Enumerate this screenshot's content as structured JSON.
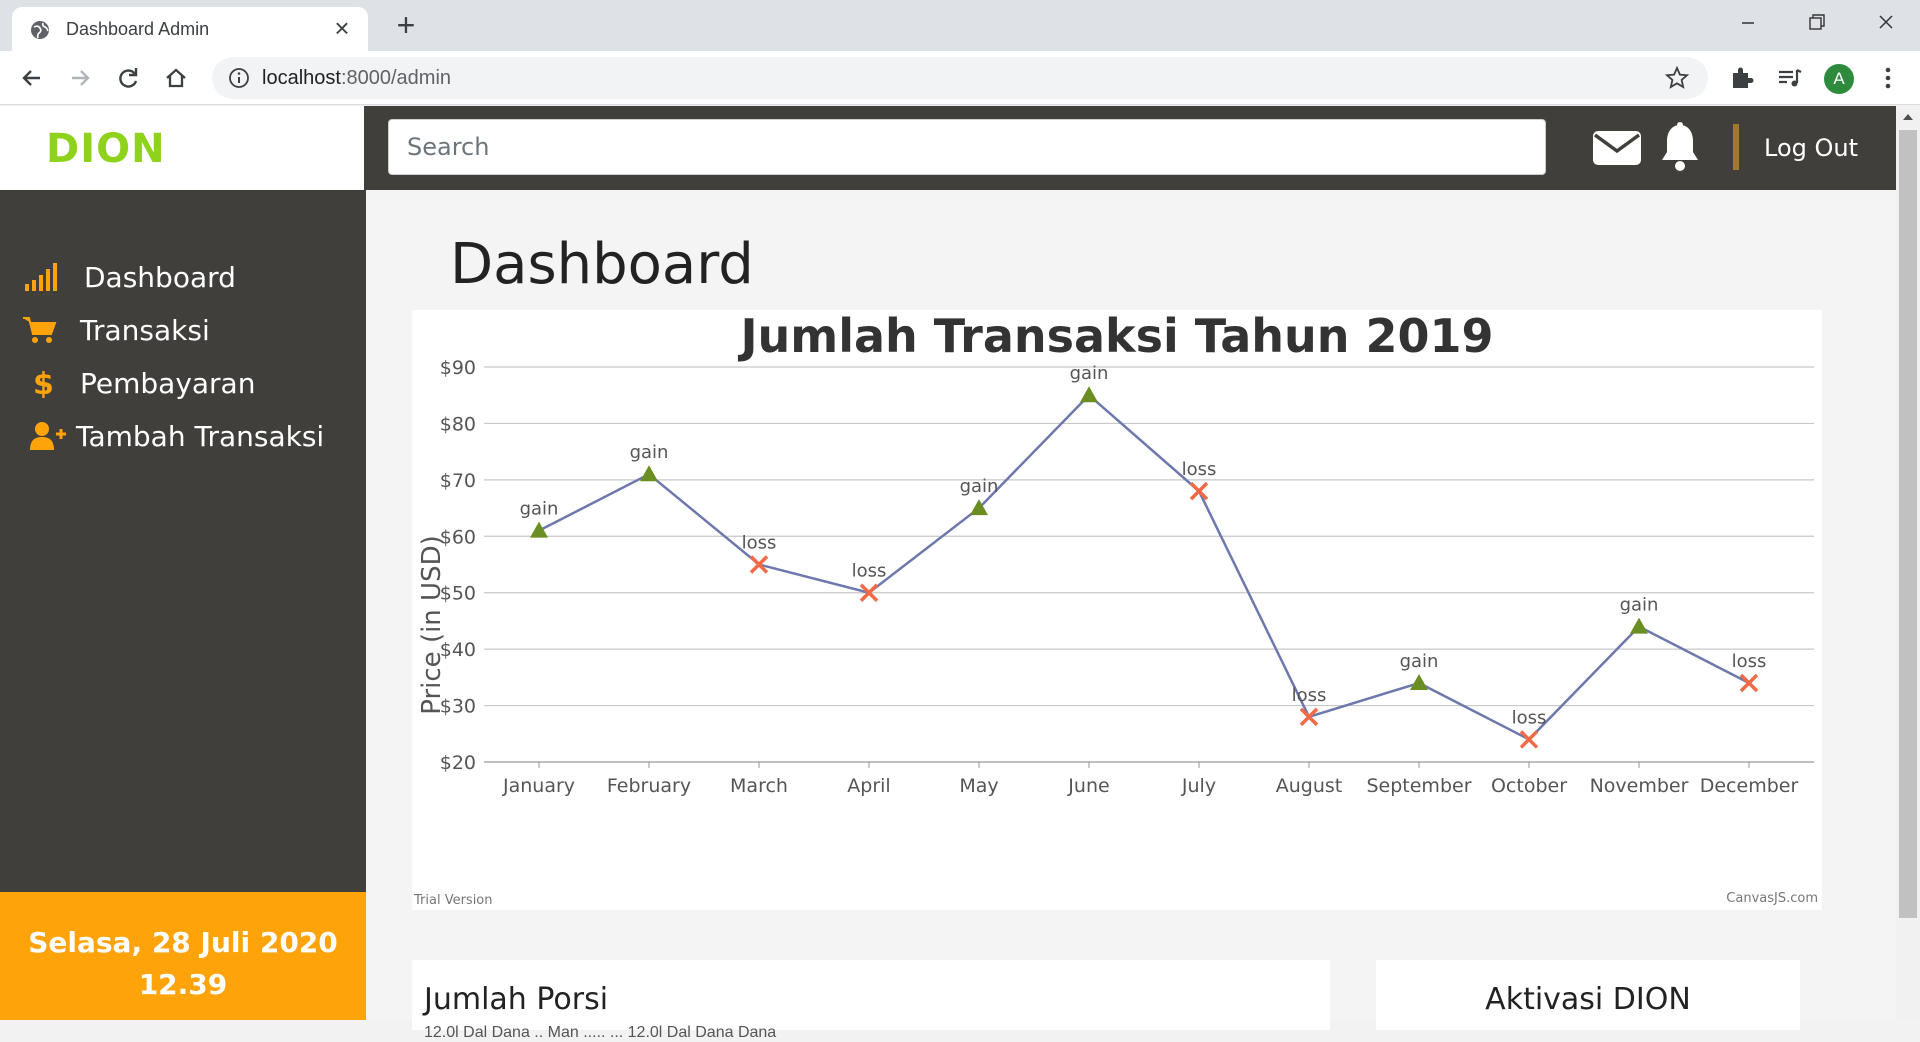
{
  "browser": {
    "tab_title": "Dashboard Admin",
    "url_host": "localhost",
    "url_path": ":8000/admin",
    "profile_initial": "A"
  },
  "app": {
    "logo": "DION",
    "search_placeholder": "Search",
    "logout_label": "Log Out",
    "accent_color": "#ffa30a",
    "logo_color": "#8fd21c"
  },
  "sidebar": {
    "items": [
      {
        "label": "Dashboard",
        "icon": "signal-bars-icon"
      },
      {
        "label": "Transaksi",
        "icon": "cart-icon"
      },
      {
        "label": "Pembayaran",
        "icon": "dollar-icon"
      },
      {
        "label": "Tambah Transaksi",
        "icon": "add-user-icon"
      }
    ],
    "date_line1": "Selasa, 28 Juli 2020",
    "date_line2": "12.39"
  },
  "main": {
    "page_title": "Dashboard",
    "card2_title": "Jumlah Porsi",
    "card2_sub": "12.0l Dal Dana .. Man ..... ... 12.0l Dal Dana Dana",
    "card3_title": "Aktivasi DION"
  },
  "chart_data": {
    "type": "line",
    "title": "Jumlah Transaksi Tahun 2019",
    "xlabel": "",
    "ylabel": "Price (in USD)",
    "ylim": [
      20,
      90
    ],
    "y_ticks": [
      "$20",
      "$30",
      "$40",
      "$50",
      "$60",
      "$70",
      "$80",
      "$90"
    ],
    "categories": [
      "January",
      "February",
      "March",
      "April",
      "May",
      "June",
      "July",
      "August",
      "September",
      "October",
      "November",
      "December"
    ],
    "values": [
      61,
      71,
      55,
      50,
      65,
      85,
      68,
      28,
      34,
      24,
      44,
      34
    ],
    "labels": [
      "gain",
      "gain",
      "loss",
      "loss",
      "gain",
      "gain",
      "loss",
      "loss",
      "gain",
      "loss",
      "gain",
      "loss"
    ],
    "line_color": "#6d78ad",
    "gain_color": "#6b8e23",
    "loss_color": "#f06a48",
    "grid": true,
    "watermark_left": "Trial Version",
    "watermark_right": "CanvasJS.com"
  }
}
